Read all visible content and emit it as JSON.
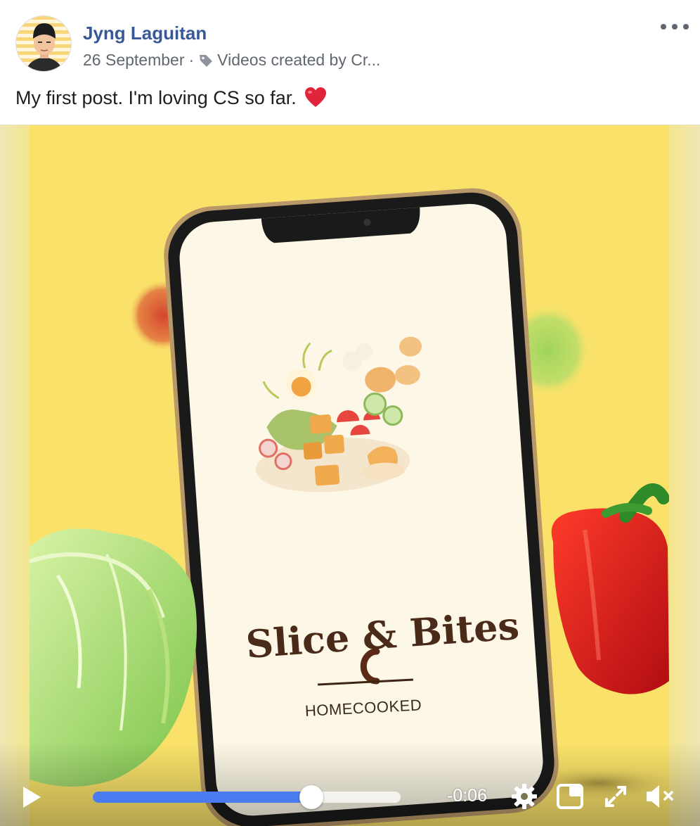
{
  "post": {
    "author": "Jyng Laguitan",
    "date": "26 September",
    "separator": "·",
    "tag_text": "Videos created by Cr...",
    "text": "My first post. I'm loving CS so far.",
    "icons": {
      "more": "more-options-icon",
      "tag": "tag-icon",
      "heart": "heart-emoji-icon"
    }
  },
  "video": {
    "app_title": "Slice & Bites",
    "app_subtitle": "HOMECOOKED",
    "time_remaining": "-0:06",
    "progress": 0.71,
    "icons": [
      "play-icon",
      "settings-gear-icon",
      "picture-in-picture-icon",
      "fullscreen-icon",
      "muted-speaker-icon"
    ]
  },
  "colors": {
    "author_link": "#385898",
    "background_yellow": "#fae26a",
    "progress_blue": "#4a7bf0",
    "title_brown": "#4a2a18"
  }
}
